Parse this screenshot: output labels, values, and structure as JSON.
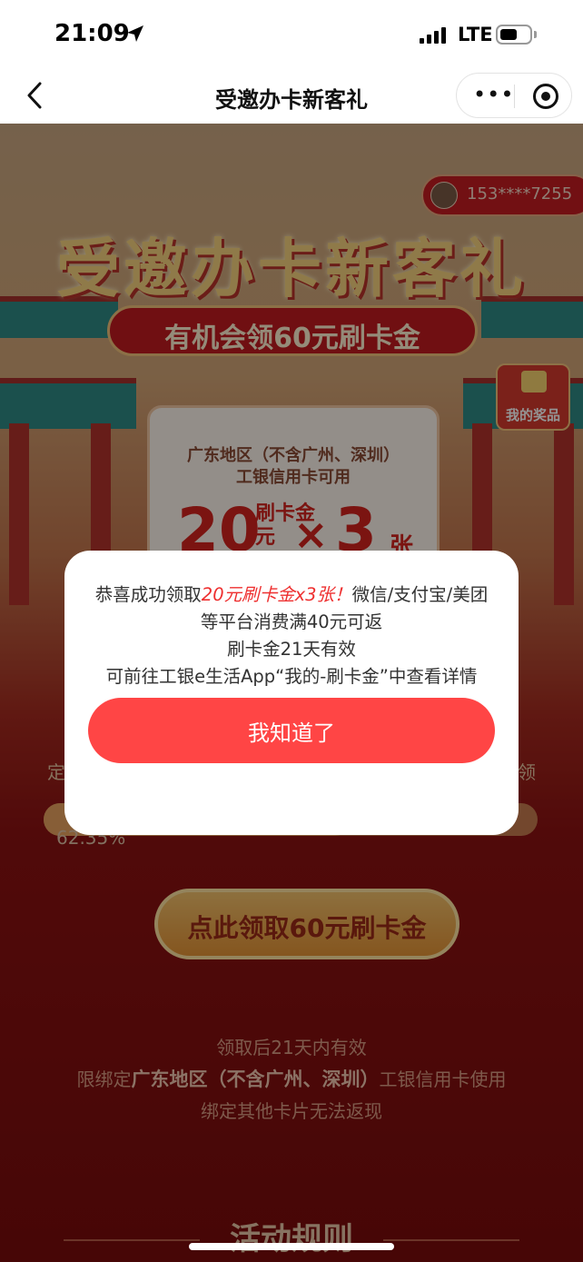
{
  "status_bar": {
    "time": "21:09",
    "network": "LTE"
  },
  "nav": {
    "title": "受邀办卡新客礼",
    "more_icon": "•••"
  },
  "banner": {
    "user_phone": "153****7255",
    "main_title": "受邀办卡新客礼",
    "subtitle": "有机会领60元刷卡金",
    "prize_label": "我的奖品",
    "card": {
      "line1": "广东地区（不含广州、深圳）",
      "line2": "工银信用卡可用",
      "amount": "20",
      "amount_unit_top": "刷卡金",
      "amount_unit_bottom": "元",
      "times": "×",
      "count": "3",
      "count_unit": "张"
    }
  },
  "progress": {
    "left_text": "定",
    "right_text": "领",
    "percent_text": "62.35%",
    "fraction": 0.6235
  },
  "cta": {
    "label": "点此领取60元刷卡金"
  },
  "notes": {
    "line1": "领取后21天内有效",
    "line2_prefix": "限绑定",
    "line2_highlight": "广东地区（不含广州、深圳）",
    "line2_suffix": "工银信用卡使用",
    "line3": "绑定其他卡片无法返现"
  },
  "rules_title": "活动规则",
  "modal": {
    "msg_prefix": "恭喜成功领取",
    "msg_emphasis": "20元刷卡金x3张！",
    "msg_rest": "微信/支付宝/美团等平台消费满40元可返",
    "line2": "刷卡金21天有效",
    "line3": "可前往工银e生活App“我的-刷卡金”中查看详情",
    "button": "我知道了"
  }
}
